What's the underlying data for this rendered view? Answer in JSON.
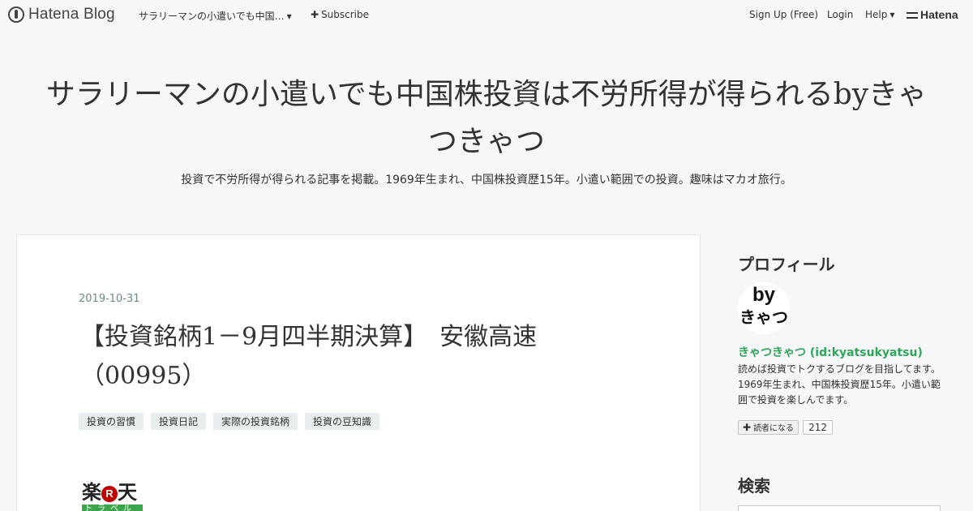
{
  "topbar": {
    "logo_text": "Hatena Blog",
    "blog_menu_label": "サラリーマンの小遣いでも中国…",
    "subscribe_label": "Subscribe",
    "signup_label": "Sign Up (Free)",
    "login_label": "Login",
    "help_label": "Help",
    "brand_label": "Hatena"
  },
  "header": {
    "title": "サラリーマンの小遣いでも中国株投資は不労所得が得られるbyきゃつきゃつ",
    "description": "投資で不労所得が得られる記事を掲載。1969年生まれ、中国株投資歴15年。小遣い範囲での投資。趣味はマカオ旅行。"
  },
  "entry": {
    "date": "2019-10-31",
    "title": "【投資銘柄1－9月四半期決算】　安徽高速（00995）",
    "tags": [
      "投資の習慣",
      "投資日記",
      "実際の投資銘柄",
      "投資の豆知識"
    ],
    "banner_top": "楽",
    "banner_r": "R",
    "banner_top2": "天",
    "banner_bottom": "トラベル",
    "body_peek": "…"
  },
  "sidebar": {
    "profile_heading": "プロフィール",
    "avatar_line1": "by",
    "avatar_line2": "きゃつ",
    "profile_name": "きゃつきゃつ (id:kyatsukyatsu)",
    "profile_text": "読めば投資でトクするブログを目指してます。1969年生まれ、中国株投資歴15年。小遣い範囲で投資を楽しんでます。",
    "reader_button_label": "読者になる",
    "reader_count": "212",
    "search_heading": "検索"
  },
  "colors": {
    "background": "#f6f7f8",
    "profile_name": "#2ea559",
    "date": "#6b8a8f",
    "tag_bg": "#e8edef"
  }
}
